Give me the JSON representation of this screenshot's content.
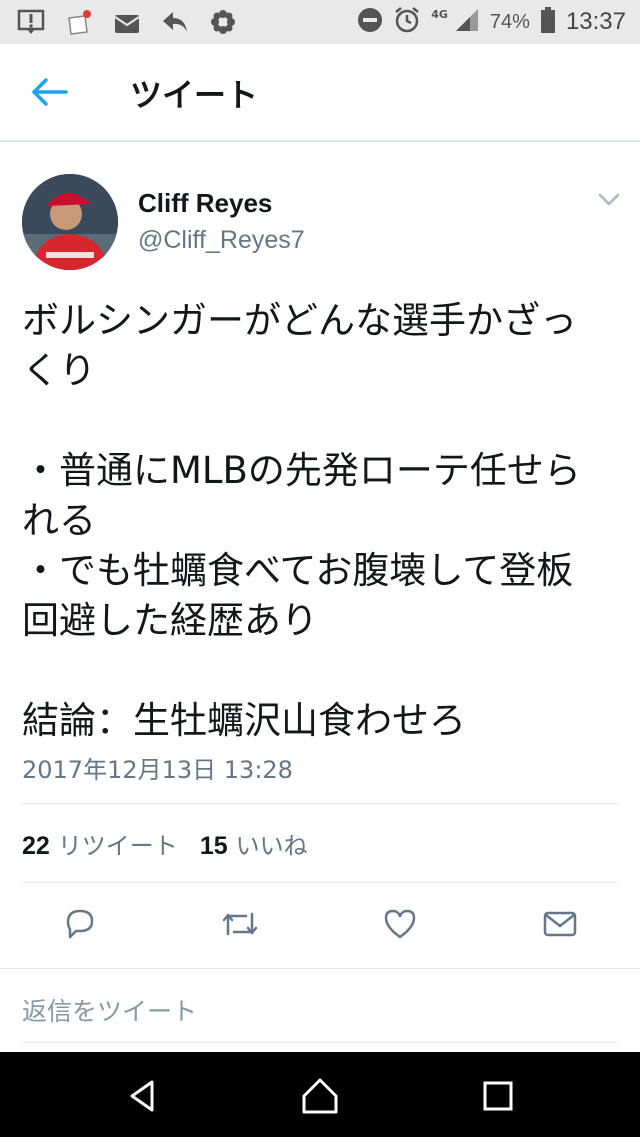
{
  "status_bar": {
    "icons_left": [
      "alert-box-icon",
      "notification-app-icon",
      "mail-app-icon",
      "reply-arrow-icon",
      "flower-app-icon"
    ],
    "network": "4G",
    "battery": "74%",
    "time": "13:37"
  },
  "header": {
    "title": "ツイート"
  },
  "tweet": {
    "author_name": "Cliff Reyes",
    "author_handle": "@Cliff_Reyes7",
    "lines": [
      "ボルシンガーがどんな選手かざっ",
      "くり",
      "",
      "・普通にMLBの先発ローテ任せら",
      "れる",
      "・でも牡蠣食べてお腹壊して登板",
      "回避した経歴あり",
      "",
      "結論：生牡蠣沢山食わせろ"
    ],
    "timestamp": "2017年12月13日 13:28",
    "retweet_count": "22",
    "retweet_label": "リツイート",
    "like_count": "15",
    "like_label": "いいね"
  },
  "reply": {
    "placeholder": "返信をツイート"
  },
  "colors": {
    "accent": "#1da1f2",
    "secondary_text": "#657786",
    "icon_gray": "#657786"
  }
}
